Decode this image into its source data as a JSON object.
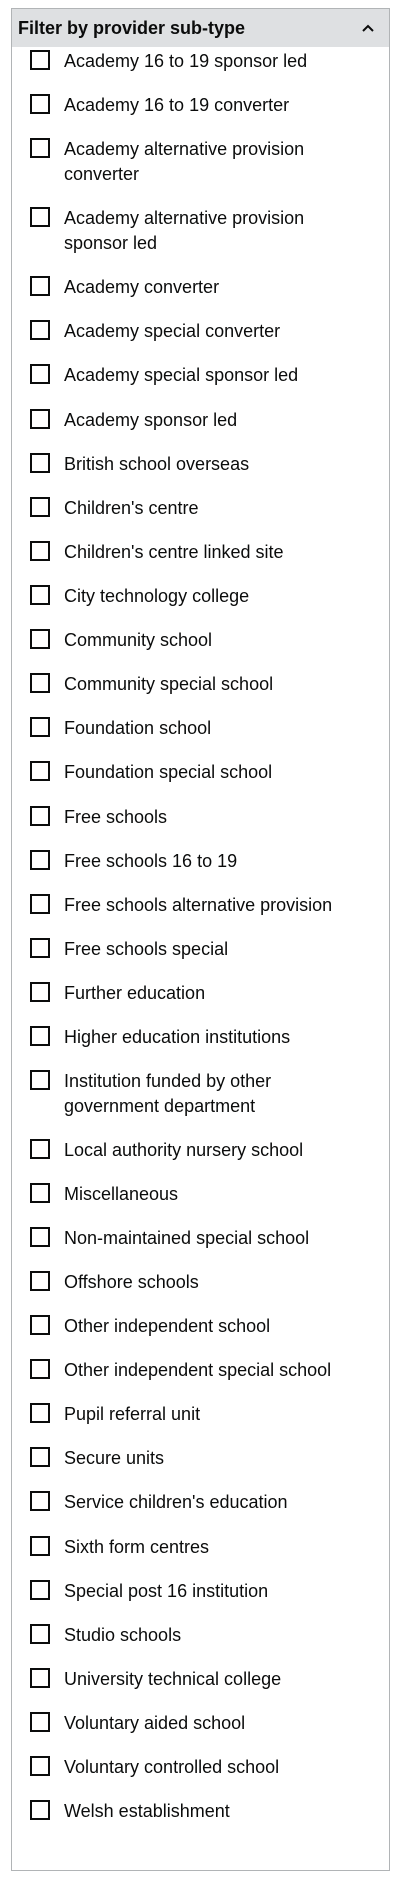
{
  "filter": {
    "title": "Filter by provider sub-type",
    "toggle_icon": "chevron-up-icon",
    "options": [
      {
        "label": "Academy 16 to 19 sponsor led",
        "checked": false
      },
      {
        "label": "Academy 16 to 19 converter",
        "checked": false
      },
      {
        "label": "Academy alternative provision converter",
        "checked": false
      },
      {
        "label": "Academy alternative provision sponsor led",
        "checked": false
      },
      {
        "label": "Academy converter",
        "checked": false
      },
      {
        "label": "Academy special converter",
        "checked": false
      },
      {
        "label": "Academy special sponsor led",
        "checked": false
      },
      {
        "label": "Academy sponsor led",
        "checked": false
      },
      {
        "label": "British school overseas",
        "checked": false
      },
      {
        "label": "Children's centre",
        "checked": false
      },
      {
        "label": "Children's centre linked site",
        "checked": false
      },
      {
        "label": "City technology college",
        "checked": false
      },
      {
        "label": "Community school",
        "checked": false
      },
      {
        "label": "Community special school",
        "checked": false
      },
      {
        "label": "Foundation school",
        "checked": false
      },
      {
        "label": "Foundation special school",
        "checked": false
      },
      {
        "label": "Free schools",
        "checked": false
      },
      {
        "label": "Free schools 16 to 19",
        "checked": false
      },
      {
        "label": "Free schools alternative provision",
        "checked": false
      },
      {
        "label": "Free schools special",
        "checked": false
      },
      {
        "label": "Further education",
        "checked": false
      },
      {
        "label": "Higher education institutions",
        "checked": false
      },
      {
        "label": "Institution funded by other government department",
        "checked": false
      },
      {
        "label": "Local authority nursery school",
        "checked": false
      },
      {
        "label": "Miscellaneous",
        "checked": false
      },
      {
        "label": "Non-maintained special school",
        "checked": false
      },
      {
        "label": "Offshore schools",
        "checked": false
      },
      {
        "label": "Other independent school",
        "checked": false
      },
      {
        "label": "Other independent special school",
        "checked": false
      },
      {
        "label": "Pupil referral unit",
        "checked": false
      },
      {
        "label": "Secure units",
        "checked": false
      },
      {
        "label": "Service children's education",
        "checked": false
      },
      {
        "label": "Sixth form centres",
        "checked": false
      },
      {
        "label": "Special post 16 institution",
        "checked": false
      },
      {
        "label": "Studio schools",
        "checked": false
      },
      {
        "label": "University technical college",
        "checked": false
      },
      {
        "label": "Voluntary aided school",
        "checked": false
      },
      {
        "label": "Voluntary controlled school",
        "checked": false
      },
      {
        "label": "Welsh establishment",
        "checked": false
      }
    ]
  }
}
